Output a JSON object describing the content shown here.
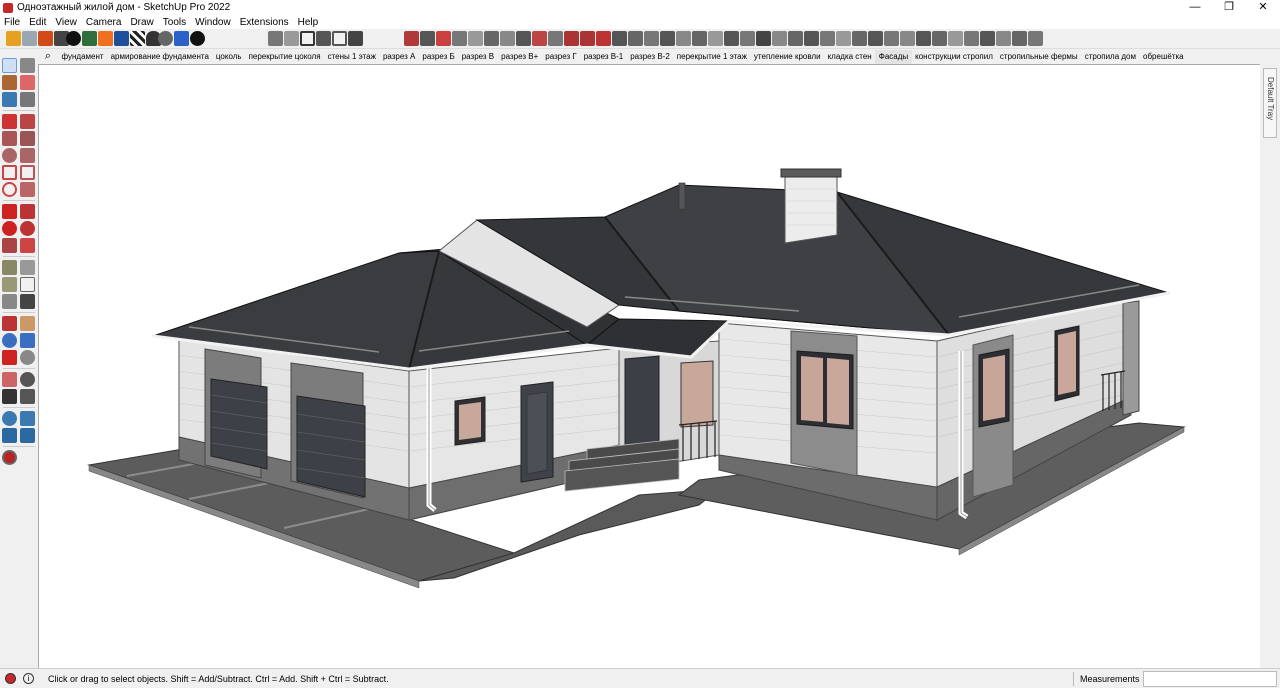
{
  "window": {
    "title": "Одноэтажный жилой дом - SketchUp Pro 2022",
    "minimize_glyph": "—",
    "maximize_glyph": "❐",
    "close_glyph": "✕"
  },
  "menu": [
    "File",
    "Edit",
    "View",
    "Camera",
    "Draw",
    "Tools",
    "Window",
    "Extensions",
    "Help"
  ],
  "scenes": {
    "search_glyph": "⌕",
    "items": [
      "фундамент",
      "армирование фундамента",
      "цоколь",
      "перекрытие цоколя",
      "стены 1 этаж",
      "разрез А",
      "разрез Б",
      "разрез В",
      "разрез В+",
      "разрез Г",
      "разрез В-1",
      "разрез В-2",
      "перекрытие 1 этаж",
      "утепление кровли",
      "кладка стен",
      "Фасады",
      "конструкции стропил",
      "стропильные фермы",
      "стропила дом",
      "обрешётка"
    ],
    "active": "Фасады"
  },
  "right_tray": {
    "label": "Default Tray"
  },
  "status": {
    "geo_icon": "geo-location-icon",
    "info_glyph": "i",
    "message": "Click or drag to select objects. Shift = Add/Subtract. Ctrl = Add. Shift + Ctrl = Subtract.",
    "measurements_label": "Measurements",
    "measurements_value": ""
  },
  "colors": {
    "roof": "#3a3c40",
    "wall": "#e6e6e6",
    "plinth": "#6e6e6e",
    "panel": "#8a8a8a",
    "ground": "#5a5a5a",
    "accent_red": "#c62828"
  }
}
